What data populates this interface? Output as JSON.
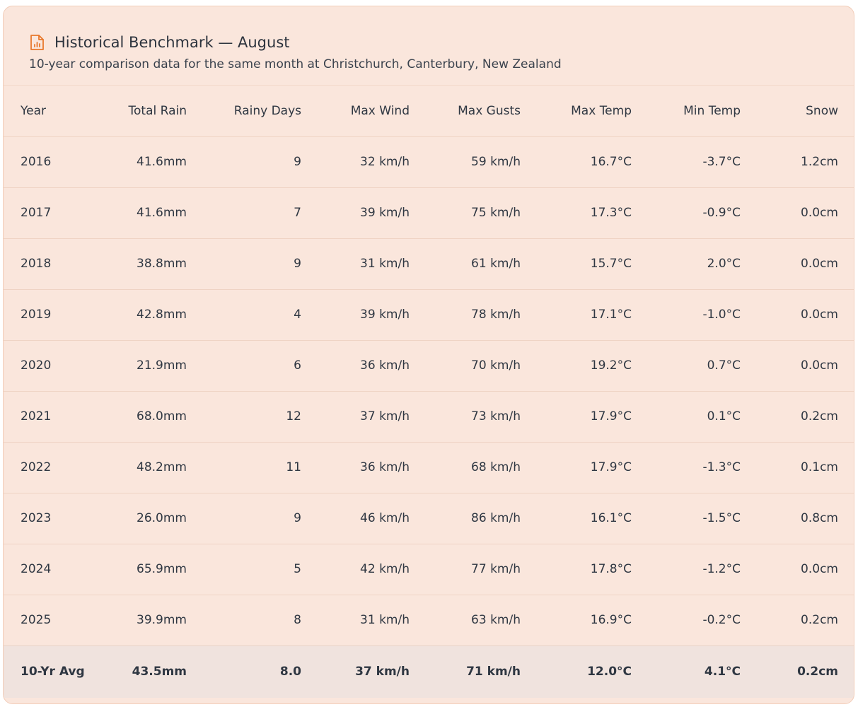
{
  "panel": {
    "title": "Historical Benchmark — August",
    "subtitle": "10-year comparison data for the same month at Christchurch, Canterbury, New Zealand",
    "icon": "report-chart-icon",
    "accent_color": "#e8782c"
  },
  "table": {
    "columns": [
      "Year",
      "Total Rain",
      "Rainy Days",
      "Max Wind",
      "Max Gusts",
      "Max Temp",
      "Min Temp",
      "Snow"
    ],
    "rows": [
      [
        "2016",
        "41.6mm",
        "9",
        "32 km/h",
        "59 km/h",
        "16.7°C",
        "-3.7°C",
        "1.2cm"
      ],
      [
        "2017",
        "41.6mm",
        "7",
        "39 km/h",
        "75 km/h",
        "17.3°C",
        "-0.9°C",
        "0.0cm"
      ],
      [
        "2018",
        "38.8mm",
        "9",
        "31 km/h",
        "61 km/h",
        "15.7°C",
        "2.0°C",
        "0.0cm"
      ],
      [
        "2019",
        "42.8mm",
        "4",
        "39 km/h",
        "78 km/h",
        "17.1°C",
        "-1.0°C",
        "0.0cm"
      ],
      [
        "2020",
        "21.9mm",
        "6",
        "36 km/h",
        "70 km/h",
        "19.2°C",
        "0.7°C",
        "0.0cm"
      ],
      [
        "2021",
        "68.0mm",
        "12",
        "37 km/h",
        "73 km/h",
        "17.9°C",
        "0.1°C",
        "0.2cm"
      ],
      [
        "2022",
        "48.2mm",
        "11",
        "36 km/h",
        "68 km/h",
        "17.9°C",
        "-1.3°C",
        "0.1cm"
      ],
      [
        "2023",
        "26.0mm",
        "9",
        "46 km/h",
        "86 km/h",
        "16.1°C",
        "-1.5°C",
        "0.8cm"
      ],
      [
        "2024",
        "65.9mm",
        "5",
        "42 km/h",
        "77 km/h",
        "17.8°C",
        "-1.2°C",
        "0.0cm"
      ],
      [
        "2025",
        "39.9mm",
        "8",
        "31 km/h",
        "63 km/h",
        "16.9°C",
        "-0.2°C",
        "0.2cm"
      ]
    ],
    "average": [
      "10-Yr Avg",
      "43.5mm",
      "8.0",
      "37 km/h",
      "71 km/h",
      "12.0°C",
      "4.1°C",
      "0.2cm"
    ]
  }
}
